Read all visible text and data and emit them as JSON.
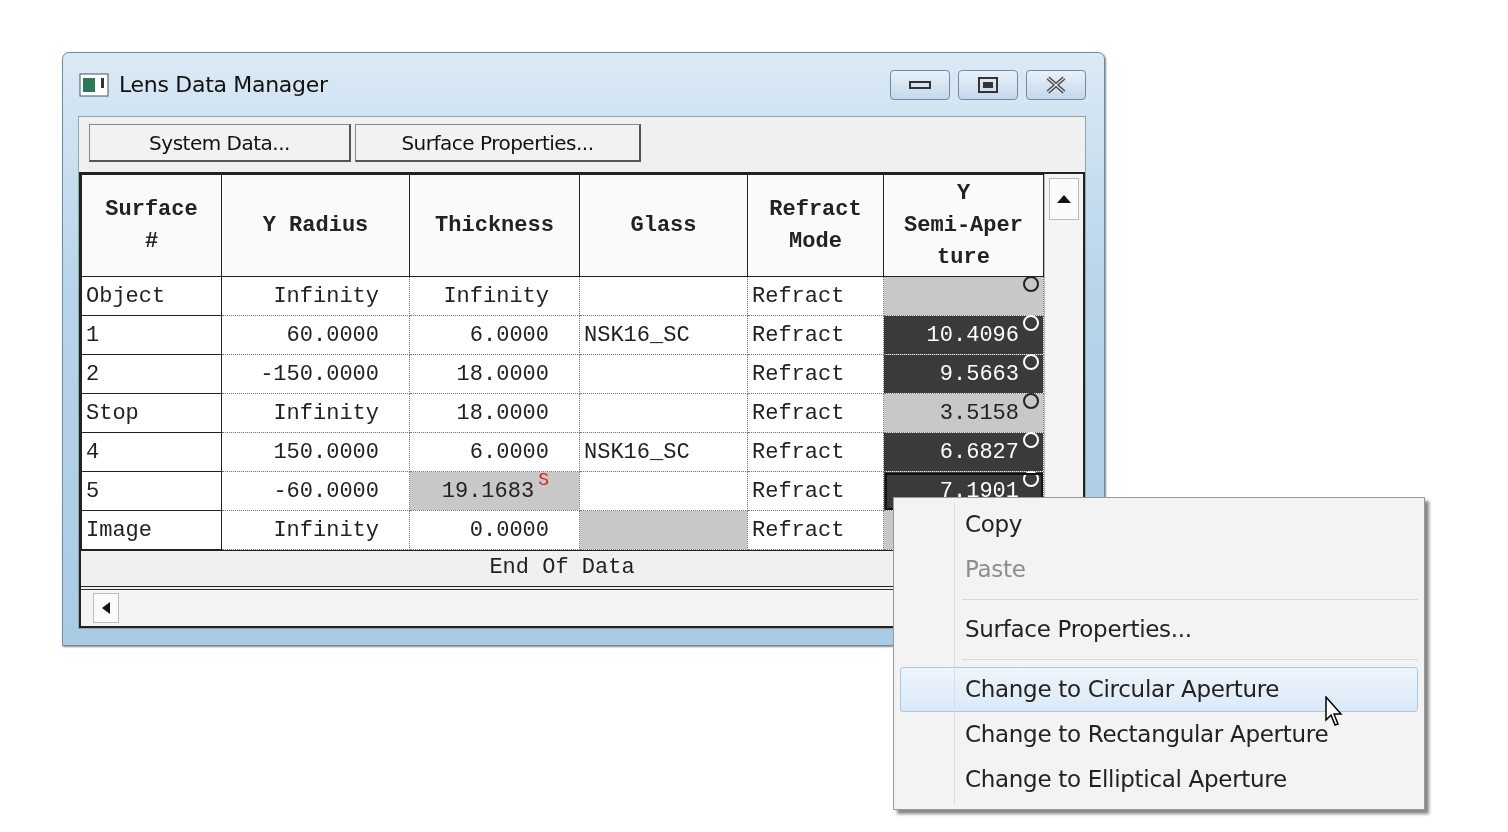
{
  "window": {
    "title": "Lens Data Manager"
  },
  "toolbar": [
    {
      "label": "System Data..."
    },
    {
      "label": "Surface Properties..."
    }
  ],
  "table": {
    "columns": [
      {
        "lines": [
          "Surface",
          "#"
        ]
      },
      {
        "lines": [
          "Y Radius"
        ]
      },
      {
        "lines": [
          "Thickness"
        ]
      },
      {
        "lines": [
          "Glass"
        ]
      },
      {
        "lines": [
          "Refract",
          "Mode"
        ]
      },
      {
        "lines": [
          "Y",
          "Semi-Aper",
          "ture"
        ]
      }
    ],
    "rows": [
      {
        "cells": [
          {
            "text": "Object"
          },
          {
            "text": "Infinity"
          },
          {
            "text": "Infinity"
          },
          {},
          {
            "text": "Refract"
          },
          {
            "kind": "gray",
            "circle": true
          }
        ]
      },
      {
        "cells": [
          {
            "text": "1"
          },
          {
            "text": "60.0000"
          },
          {
            "text": "6.0000"
          },
          {
            "text": "NSK16_SC"
          },
          {
            "text": "Refract"
          },
          {
            "text": "10.4096",
            "kind": "dark",
            "circle": true
          }
        ]
      },
      {
        "cells": [
          {
            "text": "2"
          },
          {
            "text": "-150.0000"
          },
          {
            "text": "18.0000"
          },
          {},
          {
            "text": "Refract"
          },
          {
            "text": "9.5663",
            "kind": "dark",
            "circle": true
          }
        ]
      },
      {
        "cells": [
          {
            "text": "Stop"
          },
          {
            "text": "Infinity"
          },
          {
            "text": "18.0000"
          },
          {},
          {
            "text": "Refract"
          },
          {
            "text": "3.5158",
            "kind": "gray",
            "circle": true
          }
        ]
      },
      {
        "cells": [
          {
            "text": "4"
          },
          {
            "text": "150.0000"
          },
          {
            "text": "6.0000"
          },
          {
            "text": "NSK16_SC"
          },
          {
            "text": "Refract"
          },
          {
            "text": "6.6827",
            "kind": "dark",
            "circle": true
          }
        ]
      },
      {
        "cells": [
          {
            "text": "5"
          },
          {
            "text": "-60.0000"
          },
          {
            "text": "19.1683",
            "kind": "gray",
            "flag": "S"
          },
          {},
          {
            "text": "Refract"
          },
          {
            "text": "7.1901",
            "kind": "dark",
            "circle": true,
            "focused": true
          }
        ]
      },
      {
        "cells": [
          {
            "text": "Image"
          },
          {
            "text": "Infinity"
          },
          {
            "text": "0.0000"
          },
          {
            "kind": "gray"
          },
          {
            "text": "Refract"
          },
          {
            "kind": "gray"
          }
        ]
      }
    ],
    "end_row": "End Of Data"
  },
  "context_menu": {
    "items": [
      {
        "kind": "item",
        "label": "Copy",
        "disabled": false,
        "selected": false
      },
      {
        "kind": "item",
        "label": "Paste",
        "disabled": true,
        "selected": false
      },
      {
        "kind": "separator"
      },
      {
        "kind": "item",
        "label": "Surface Properties...",
        "disabled": false,
        "selected": false
      },
      {
        "kind": "separator"
      },
      {
        "kind": "item",
        "label": "Change to Circular Aperture",
        "disabled": false,
        "selected": true
      },
      {
        "kind": "item",
        "label": "Change to Rectangular Aperture",
        "disabled": false,
        "selected": false
      },
      {
        "kind": "item",
        "label": "Change to Elliptical Aperture",
        "disabled": false,
        "selected": false
      }
    ]
  }
}
